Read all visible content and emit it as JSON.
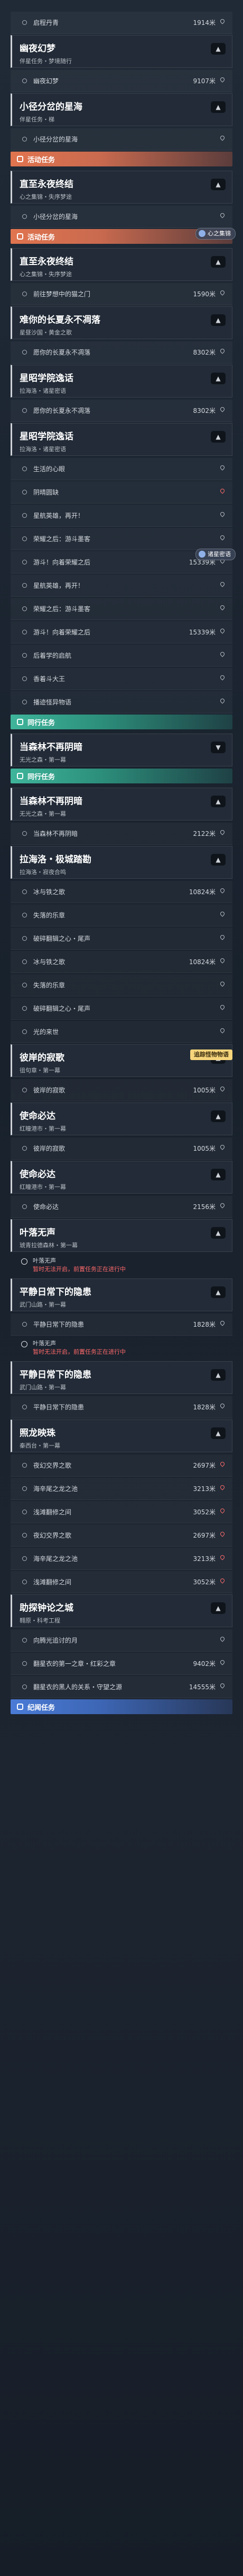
{
  "labels": {
    "activity": "活动任务",
    "companion": "同行任务",
    "discovery": "纪闻任务",
    "locked_title": "暂时无法开启",
    "locked_reason": "前置任务正在进行中"
  },
  "rows": [
    {
      "k": "step",
      "name": "启程丹青",
      "dist": "1914米"
    },
    {
      "k": "mission",
      "title": "幽夜幻梦",
      "sub": "伴星任务・梦境随行",
      "toggle": "▲"
    },
    {
      "k": "step",
      "name": "幽夜幻梦",
      "dist": "9107米"
    },
    {
      "k": "mission",
      "title": "小径分岔的星海",
      "sub": "伴星任务・梯",
      "toggle": "▲"
    },
    {
      "k": "step",
      "name": "小径分岔的星海",
      "dist": ""
    },
    {
      "k": "cat",
      "cls": "activity",
      "label_key": "activity"
    },
    {
      "k": "mission",
      "title": "直至永夜终结",
      "sub": "心之集锦・失序梦途",
      "toggle": "▲"
    },
    {
      "k": "step",
      "name": "小径分岔的星海",
      "dist": ""
    },
    {
      "k": "cat",
      "cls": "activity",
      "label_key": "activity"
    },
    {
      "k": "mission",
      "title": "直至永夜终结",
      "sub": "心之集锦・失序梦途",
      "toggle": "▲"
    },
    {
      "k": "step",
      "name": "前往梦想中的猫之门",
      "dist": "1590米"
    },
    {
      "k": "mission",
      "title": "难你的长夏永不凋落",
      "sub": "星昼沙国・黄金之歌",
      "toggle": "▲"
    },
    {
      "k": "step",
      "name": "愿你的长夏永不凋落",
      "dist": "8302米"
    },
    {
      "k": "mission",
      "title": "星昭学院逸话",
      "sub": "拉海洛・诸星密语",
      "toggle": "▲"
    },
    {
      "k": "step",
      "name": "愿你的长夏永不凋落",
      "dist": "8302米"
    },
    {
      "k": "mission",
      "title": "星昭学院逸话",
      "sub": "拉海洛・诸星密语",
      "toggle": "▲"
    },
    {
      "k": "step",
      "name": "生活的心眼",
      "dist": ""
    },
    {
      "k": "step",
      "name": "阴晴圆缺",
      "dist": "",
      "pin": "red"
    },
    {
      "k": "step",
      "name": "星航英雄，再开！",
      "dist": ""
    },
    {
      "k": "step",
      "name": "荣耀之后：游斗墨客",
      "dist": ""
    },
    {
      "k": "step",
      "name": "游斗！向着荣耀之后",
      "dist": "15339米"
    },
    {
      "k": "step",
      "name": "星航英雄，再开！",
      "dist": ""
    },
    {
      "k": "step",
      "name": "荣耀之后：游斗墨客",
      "dist": ""
    },
    {
      "k": "step",
      "name": "游斗！向着荣耀之后",
      "dist": "15339米"
    },
    {
      "k": "step",
      "name": "后着学的启航",
      "dist": ""
    },
    {
      "k": "step",
      "name": "香着斗大王",
      "dist": ""
    },
    {
      "k": "step",
      "name": "播迹怪异物语",
      "dist": ""
    },
    {
      "k": "cat",
      "cls": "companion",
      "label_key": "companion"
    },
    {
      "k": "mission",
      "title": "当森林不再阴暗",
      "sub": "无光之森・第一幕",
      "toggle": "▼"
    },
    {
      "k": "cat",
      "cls": "companion",
      "label_key": "companion"
    },
    {
      "k": "mission",
      "title": "当森林不再阴暗",
      "sub": "无光之森・第一幕",
      "toggle": "▲"
    },
    {
      "k": "step",
      "name": "当森林不再阴暗",
      "dist": "2122米"
    },
    {
      "k": "mission",
      "title": "拉海洛・极城踏勘",
      "sub": "拉海洛・寂夜合鸣",
      "toggle": "▲"
    },
    {
      "k": "step",
      "name": "冰与铁之歌",
      "dist": "10824米"
    },
    {
      "k": "step",
      "name": "失落的乐章",
      "dist": ""
    },
    {
      "k": "step",
      "name": "破碎翻辑之心・尾声",
      "dist": ""
    },
    {
      "k": "step",
      "name": "冰与铁之歌",
      "dist": "10824米"
    },
    {
      "k": "step",
      "name": "失落的乐章",
      "dist": ""
    },
    {
      "k": "step",
      "name": "破碎翻辑之心・尾声",
      "dist": ""
    },
    {
      "k": "step",
      "name": "光的来世",
      "dist": ""
    },
    {
      "k": "mission",
      "title": "彼岸的寂歌",
      "sub": "徂句章・第一幕",
      "toggle": "▲"
    },
    {
      "k": "step",
      "name": "彼岸的寂歌",
      "dist": "1005米"
    },
    {
      "k": "mission",
      "title": "使命必达",
      "sub": "红瞳港市・第一幕",
      "toggle": "▲"
    },
    {
      "k": "step",
      "name": "彼岸的寂歌",
      "dist": "1005米"
    },
    {
      "k": "mission",
      "title": "使命必达",
      "sub": "红瞳港市・第一幕",
      "toggle": "▲"
    },
    {
      "k": "step",
      "name": "使命必达",
      "dist": "2156米"
    },
    {
      "k": "mission",
      "title": "叶落无声",
      "sub": "琥青拉德森林・第一幕",
      "toggle": "▲"
    },
    {
      "k": "warn",
      "title": "叶落无声"
    },
    {
      "k": "mission",
      "title": "平静日常下的隐患",
      "sub": "武门山路・第一幕",
      "toggle": "▲"
    },
    {
      "k": "step",
      "name": "平静日常下的隐患",
      "dist": "1828米"
    },
    {
      "k": "warn",
      "title": "叶落无声"
    },
    {
      "k": "mission",
      "title": "平静日常下的隐患",
      "sub": "武门山路・第一幕",
      "toggle": "▲"
    },
    {
      "k": "step",
      "name": "平静日常下的隐患",
      "dist": "1828米"
    },
    {
      "k": "mission",
      "title": "照龙映珠",
      "sub": "秦西台・第一幕",
      "toggle": "▲"
    },
    {
      "k": "step",
      "name": "夜幻交界之歌",
      "dist": "2697米",
      "pin": "red"
    },
    {
      "k": "step",
      "name": "海辛尾之龙之池",
      "dist": "3213米",
      "pin": "red"
    },
    {
      "k": "step",
      "name": "浅滩翻修之间",
      "dist": "3052米",
      "pin": "red"
    },
    {
      "k": "step",
      "name": "夜幻交界之歌",
      "dist": "2697米",
      "pin": "red"
    },
    {
      "k": "step",
      "name": "海辛尾之龙之池",
      "dist": "3213米",
      "pin": "red"
    },
    {
      "k": "step",
      "name": "浅滩翻修之间",
      "dist": "3052米",
      "pin": "red"
    },
    {
      "k": "mission",
      "title": "助探钟论之城",
      "sub": "翱原・科考工程",
      "toggle": "▲"
    },
    {
      "k": "step",
      "name": "向腾光追讨的月",
      "dist": ""
    },
    {
      "k": "step",
      "name": "翻星衣的第一之章・红彩之章",
      "dist": "9402米"
    },
    {
      "k": "step",
      "name": "翻星衣的黑人的关系・守望之源",
      "dist": "14555米"
    },
    {
      "k": "cat",
      "cls": "discovery",
      "label_key": "discovery"
    }
  ],
  "floating": [
    {
      "text": "心之集锦",
      "icon": "heart-icon"
    },
    {
      "text": "诸星密语",
      "icon": "star-icon"
    },
    {
      "text": "追踪怪物物语",
      "icon": "target-icon"
    }
  ]
}
